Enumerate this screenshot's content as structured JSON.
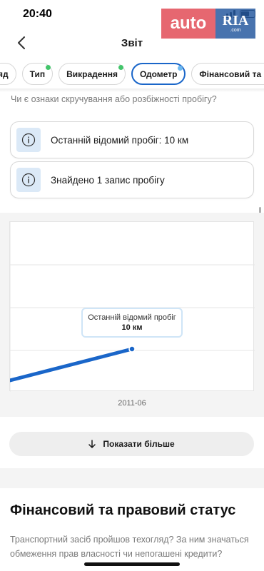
{
  "status_bar": {
    "time": "20:40"
  },
  "watermark": {
    "auto": "auto",
    "ria": "RIA",
    "domain": ".com"
  },
  "nav": {
    "title": "Звіт"
  },
  "tabs": [
    {
      "label": "яд",
      "dot": ""
    },
    {
      "label": "Тип",
      "dot": "#43c56b"
    },
    {
      "label": "Викрадення",
      "dot": "#43c56b"
    },
    {
      "label": "Одометр",
      "dot": "#6eb9ef",
      "active": true
    },
    {
      "label": "Фінансовий та правовий статус",
      "dot": ""
    }
  ],
  "odometer": {
    "question": "Чи є ознаки скручування або розбіжності пробігу?",
    "cards": [
      {
        "icon": "info-icon",
        "text": "Останній відомий пробіг: 10 км"
      },
      {
        "icon": "info-icon",
        "text": "Знайдено 1 запис пробігу"
      }
    ]
  },
  "chart_data": {
    "type": "line",
    "x": [
      "2011-06"
    ],
    "series": [
      {
        "values": [
          10
        ]
      }
    ],
    "tooltip": {
      "title": "Останній відомий пробіг",
      "value": "10 км"
    },
    "grid": true,
    "line_color": "#1a66c9"
  },
  "actions": {
    "show_more": "Показати більше"
  },
  "financial": {
    "title": "Фінансовий та правовий статус",
    "description": "Транспортний засіб пройшов техогляд? За ним значаться обмеження прав власності чи непогашені кредити?"
  },
  "colors": {
    "accent": "#1a66c9",
    "info_box": "#dbe9f7"
  }
}
